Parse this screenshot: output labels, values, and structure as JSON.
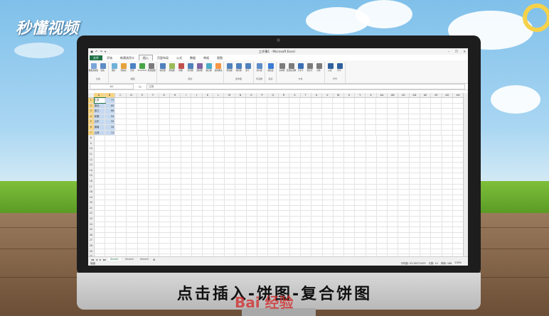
{
  "watermark": "秒懂视频",
  "window": {
    "title": "工作簿1 - Microsoft Excel",
    "qa": [
      "▣",
      "↶",
      "↷",
      "▾"
    ],
    "controls": [
      "–",
      "❐",
      "✕"
    ]
  },
  "menus": [
    "文件",
    "开始",
    "新建选项卡",
    "插入",
    "页面布局",
    "公式",
    "数据",
    "审阅",
    "视图"
  ],
  "ribbon_groups": [
    {
      "title": "表格",
      "items": [
        {
          "label": "数据透视表",
          "color": "#7aa6d8"
        },
        {
          "label": "表格",
          "color": "#5d8cc7"
        }
      ]
    },
    {
      "title": "插图",
      "items": [
        {
          "label": "图片",
          "color": "#6fb0d9"
        },
        {
          "label": "剪贴画",
          "color": "#e6a23c"
        },
        {
          "label": "形状",
          "color": "#4b82c4"
        },
        {
          "label": "SmartArt",
          "color": "#47a447"
        },
        {
          "label": "屏幕截图",
          "color": "#7b7b7b"
        }
      ]
    },
    {
      "title": "图表",
      "items": [
        {
          "label": "柱形图",
          "color": "#4f81bd"
        },
        {
          "label": "折线图",
          "color": "#9bbb59"
        },
        {
          "label": "饼图",
          "color": "#c0504d"
        },
        {
          "label": "条形图",
          "color": "#4f81bd"
        },
        {
          "label": "面积图",
          "color": "#8064a2"
        },
        {
          "label": "散点图",
          "color": "#4bacc6"
        },
        {
          "label": "其他图表",
          "color": "#f79646"
        }
      ]
    },
    {
      "title": "迷你图",
      "items": [
        {
          "label": "折线图",
          "color": "#4f81bd"
        },
        {
          "label": "柱形图",
          "color": "#4f81bd"
        },
        {
          "label": "盈亏",
          "color": "#4f81bd"
        }
      ]
    },
    {
      "title": "筛选器",
      "items": [
        {
          "label": "切片器",
          "color": "#5d8cc7"
        }
      ]
    },
    {
      "title": "链接",
      "items": [
        {
          "label": "超链接",
          "color": "#3a7bd5"
        }
      ]
    },
    {
      "title": "文本",
      "items": [
        {
          "label": "文本框",
          "color": "#7b7b7b"
        },
        {
          "label": "页眉和页脚",
          "color": "#7b7b7b"
        },
        {
          "label": "艺术字",
          "color": "#3a6fb5"
        },
        {
          "label": "签名行",
          "color": "#7b7b7b"
        },
        {
          "label": "对象",
          "color": "#7b7b7b"
        }
      ]
    },
    {
      "title": "符号",
      "items": [
        {
          "label": "公式",
          "color": "#2f5f9e"
        },
        {
          "label": "符号",
          "color": "#2f5f9e"
        }
      ]
    }
  ],
  "formula_bar": {
    "name_box": "A1",
    "fx": "fx",
    "value": "江苏"
  },
  "columns": [
    "A",
    "B",
    "C",
    "D",
    "E",
    "F",
    "G",
    "H",
    "I",
    "J",
    "K",
    "L",
    "M",
    "N",
    "O",
    "P",
    "Q",
    "R",
    "S",
    "T",
    "U",
    "V",
    "W",
    "X",
    "Y",
    "Z",
    "AA",
    "AB",
    "AC",
    "AD",
    "AE",
    "AF",
    "AG",
    "AH"
  ],
  "data_rows": [
    {
      "name": "江苏",
      "value": "77"
    },
    {
      "name": "湖北",
      "value": "60"
    },
    {
      "name": "浙江",
      "value": "66"
    },
    {
      "name": "安徽",
      "value": "54"
    },
    {
      "name": "山东",
      "value": "32"
    },
    {
      "name": "湖南",
      "value": "34"
    },
    {
      "name": "山西",
      "value": "11"
    }
  ],
  "total_rows": 33,
  "sheets": [
    "Sheet1",
    "Sheet2",
    "Sheet3"
  ],
  "status": {
    "ready": "就绪",
    "average": "平均值: 53.28571429",
    "count": "计数: 14",
    "sum": "求和: 166",
    "zoom": "100%"
  },
  "caption": "点击插入-饼图-复合饼图",
  "baidu_watermark": "Bai 经验"
}
